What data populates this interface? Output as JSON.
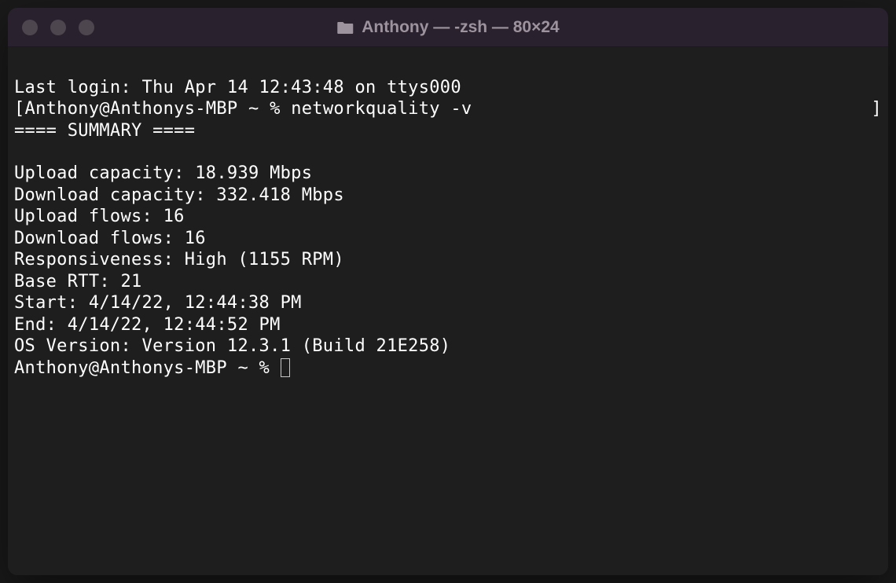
{
  "window": {
    "title": "Anthony — -zsh — 80×24"
  },
  "terminal": {
    "last_login": "Last login: Thu Apr 14 12:43:48 on ttys000",
    "prompt1_open": "[",
    "prompt1_text": "Anthony@Anthonys-MBP ~ % ",
    "command1": "networkquality -v",
    "prompt1_close": "]",
    "summary_header": "==== SUMMARY ====",
    "blank": "",
    "upload_capacity": "Upload capacity: 18.939 Mbps",
    "download_capacity": "Download capacity: 332.418 Mbps",
    "upload_flows": "Upload flows: 16",
    "download_flows": "Download flows: 16",
    "responsiveness": "Responsiveness: High (1155 RPM)",
    "base_rtt": "Base RTT: 21",
    "start": "Start: 4/14/22, 12:44:38 PM",
    "end": "End: 4/14/22, 12:44:52 PM",
    "os_version": "OS Version: Version 12.3.1 (Build 21E258)",
    "prompt2_text": "Anthony@Anthonys-MBP ~ % "
  }
}
